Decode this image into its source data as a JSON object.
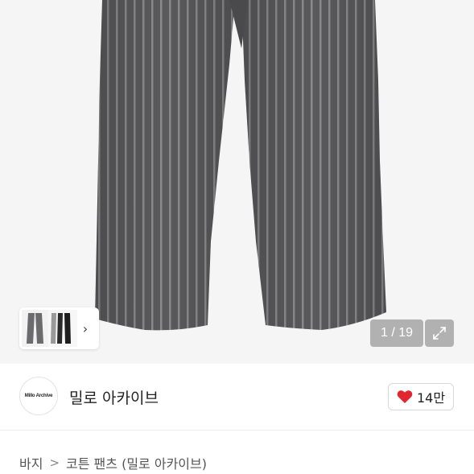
{
  "gallery": {
    "counter_text": "1 / 19",
    "thumbnail_next_label": "›",
    "icons": [
      "expand-icon",
      "chevron-right-icon"
    ]
  },
  "shop": {
    "logo_text": "Millo Archive",
    "name": "밀로 아카이브",
    "like_count": "14만",
    "like_icon": "heart-icon",
    "like_color": "#e0262f"
  },
  "breadcrumb": {
    "category": "바지",
    "separator": ">",
    "product": "코튼 팬츠 (밀로 아카이브)"
  }
}
